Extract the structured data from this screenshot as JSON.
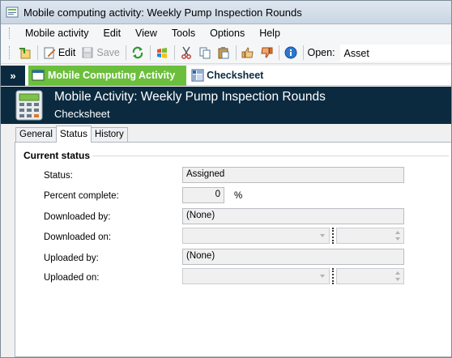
{
  "window": {
    "title": "Mobile computing activity: Weekly Pump Inspection Rounds"
  },
  "menu": [
    "Mobile activity",
    "Edit",
    "View",
    "Tools",
    "Options",
    "Help"
  ],
  "toolbar": {
    "edit_label": "Edit",
    "save_label": "Save",
    "open_label": "Open:",
    "open_value": "Asset"
  },
  "nav": {
    "active_tab": "Mobile Computing Activity",
    "tab2": "Checksheet"
  },
  "header": {
    "title": "Mobile Activity: Weekly Pump Inspection Rounds",
    "subtitle": "Checksheet"
  },
  "tabs": [
    "General",
    "Status",
    "History"
  ],
  "section": {
    "title": "Current status"
  },
  "fields": {
    "status_label": "Status:",
    "status_value": "Assigned",
    "percent_label": "Percent complete:",
    "percent_value": "0",
    "percent_unit": "%",
    "downloaded_by_label": "Downloaded by:",
    "downloaded_by_value": "(None)",
    "downloaded_on_label": "Downloaded on:",
    "uploaded_by_label": "Uploaded by:",
    "uploaded_by_value": "(None)",
    "uploaded_on_label": "Uploaded on:"
  },
  "colors": {
    "header_bg": "#0b2a40",
    "active_nav_tab": "#6bbf3c"
  },
  "icons": [
    "app-icon",
    "new-icon",
    "edit-icon",
    "save-icon",
    "refresh-icon",
    "windows-icon",
    "cut-icon",
    "copy-icon",
    "paste-icon",
    "thumbs-up-icon",
    "thumbs-down-icon",
    "info-icon",
    "calculator-icon",
    "checksheet-icon"
  ]
}
